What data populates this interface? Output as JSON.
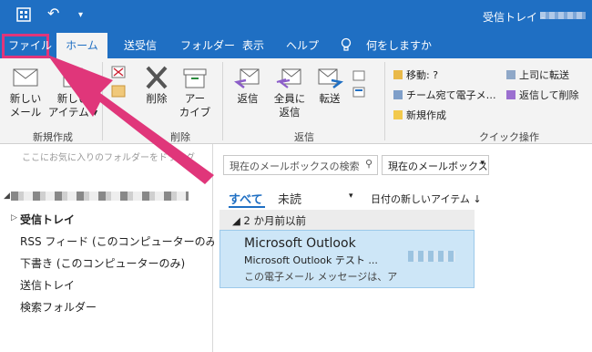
{
  "titlebar": {
    "title": "受信トレイ -",
    "qa_undo": "↶",
    "qa_more": "▾"
  },
  "tabs": [
    {
      "label": "ファイル"
    },
    {
      "label": "ホーム"
    },
    {
      "label": "送受信"
    },
    {
      "label": "フォルダー"
    },
    {
      "label": "表示"
    },
    {
      "label": "ヘルプ"
    },
    {
      "label": "何をしますか"
    }
  ],
  "ribbon": {
    "new_mail": "新しい\nメール",
    "new_items": "新しい\nアイテム ▾",
    "group_new": "新規作成",
    "delete": "削除",
    "archive": "アー\nカイブ",
    "group_delete": "削除",
    "reply": "返信",
    "reply_all": "全員に\n返信",
    "forward": "転送",
    "group_reply": "返信",
    "quick_steps": {
      "move": "移動: ?",
      "team": "チーム宛て電子メ…",
      "create": "新規作成",
      "to_manager": "上司に転送",
      "reply_delete": "返信して削除"
    },
    "group_quick": "クイック操作"
  },
  "leftpane": {
    "fav_hint": "ここにお気に入りのフォルダーをドラッグ",
    "folders": [
      {
        "label": "受信トレイ"
      },
      {
        "label": "RSS フィード (このコンピューターのみ)"
      },
      {
        "label": "下書き (このコンピューターのみ)"
      },
      {
        "label": "送信トレイ"
      },
      {
        "label": "検索フォルダー"
      }
    ]
  },
  "listpane": {
    "search_placeholder": "現在のメールボックスの検索",
    "search_scope": "現在のメールボックス",
    "filter_all": "すべて",
    "filter_unread": "未読",
    "sort": "日付の新しいアイテム ↓",
    "group_header": "◢ 2 か月前以前",
    "mail": {
      "sender": "Microsoft Outlook",
      "subject": "Microsoft Outlook テスト ...",
      "preview": "この電子メール メッセージは、ア"
    }
  },
  "colors": {
    "accent": "#1f6fc3",
    "highlight": "#e0367a",
    "selected": "#cde6f7"
  }
}
